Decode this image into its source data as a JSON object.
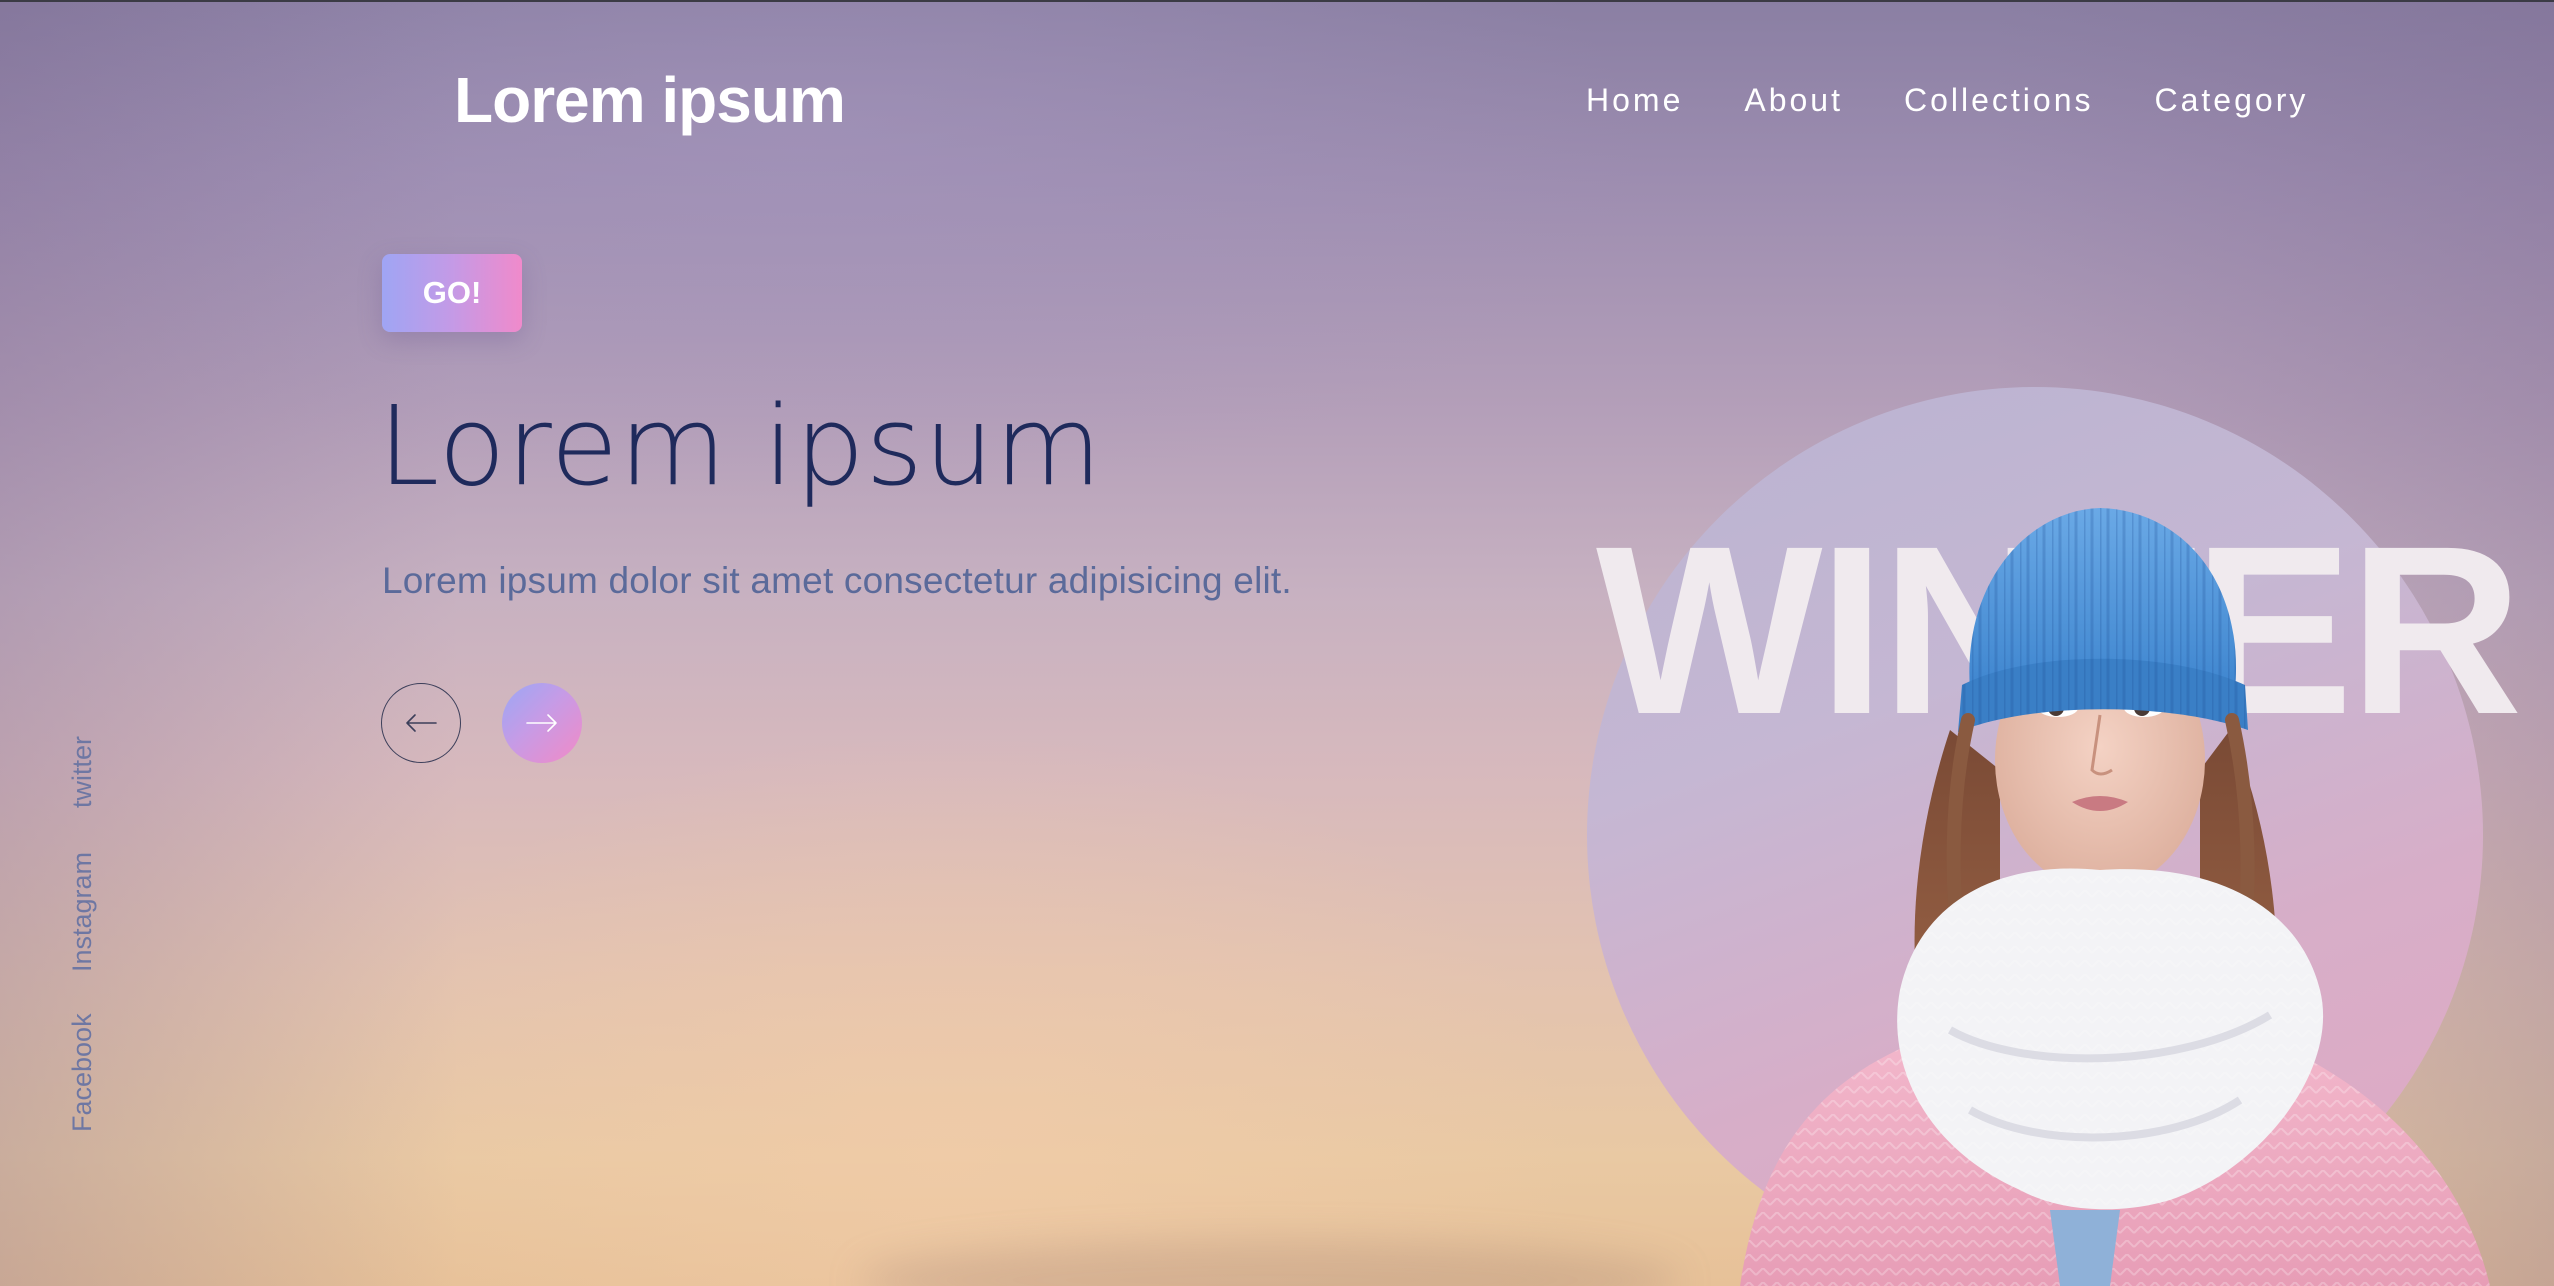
{
  "header": {
    "logo": "Lorem ipsum",
    "nav": [
      {
        "label": "Home"
      },
      {
        "label": "About"
      },
      {
        "label": "Collections"
      },
      {
        "label": "Category"
      }
    ]
  },
  "hero": {
    "cta_label": "GO!",
    "title": "Lorem ipsum",
    "subtitle": "Lorem ipsum dolor sit amet consectetur adipisicing elit.",
    "prev_icon": "arrow-left-icon",
    "next_icon": "arrow-right-icon"
  },
  "social": {
    "links": [
      {
        "label": "twitter"
      },
      {
        "label": "Instagram"
      },
      {
        "label": "Facebook"
      }
    ]
  },
  "feature": {
    "word": "WINTER",
    "image": "woman-in-winter-hat-photo"
  },
  "colors": {
    "accent_start": "#9fa5f4",
    "accent_end": "#f08acb",
    "title": "#1f2a5c",
    "subtitle": "#5b6a9a",
    "social": "#6e77a3"
  }
}
